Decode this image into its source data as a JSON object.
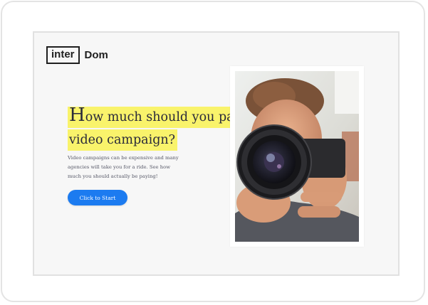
{
  "logo": {
    "boxed_text": "inter",
    "rest_text": "Dom"
  },
  "hero": {
    "headline_cap": "H",
    "headline_line1": "ow much should you pay for a",
    "headline_line2": "video campaign?",
    "description": "Video campaigns can be expensive and many agencies will take you for a ride. See how much you should actually be paying!",
    "cta_label": "Click to Start"
  },
  "image": {
    "subject": "person-holding-camera-photo"
  },
  "colors": {
    "highlight": "#f9f36b",
    "cta": "#1c7bf0",
    "screen_bg": "#f7f7f7",
    "text_dark": "#2a2a3a"
  }
}
